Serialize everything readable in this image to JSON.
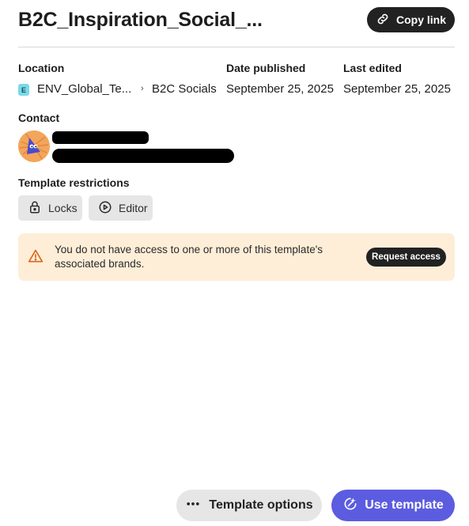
{
  "header": {
    "title": "B2C_Inspiration_Social_...",
    "copy_link_label": "Copy link",
    "copy_link_icon": "link-icon"
  },
  "details": {
    "location_label": "Location",
    "location_badge": "E",
    "location_path": [
      "ENV_Global_Te...",
      "B2C Socials"
    ],
    "location_separator": "›",
    "date_published_label": "Date published",
    "date_published": "September 25, 2025",
    "last_edited_label": "Last edited",
    "last_edited": "September 25, 2025"
  },
  "contact": {
    "label": "Contact",
    "avatar_icon": "avatar-icon"
  },
  "restrictions": {
    "label": "Template restrictions",
    "chips": [
      {
        "label": "Locks",
        "icon": "lock-icon"
      },
      {
        "label": "Editor",
        "icon": "play-circle-icon"
      }
    ]
  },
  "alert": {
    "message": "You do not have access to one or more of this template's associated brands.",
    "action_label": "Request access",
    "icon": "warning-icon",
    "background": "#feeed8",
    "icon_color": "#d9661d"
  },
  "footer": {
    "options_label": "Template options",
    "options_icon": "more-icon",
    "use_label": "Use template",
    "use_icon": "magic-edit-icon",
    "accent": "#5c5ce0"
  }
}
